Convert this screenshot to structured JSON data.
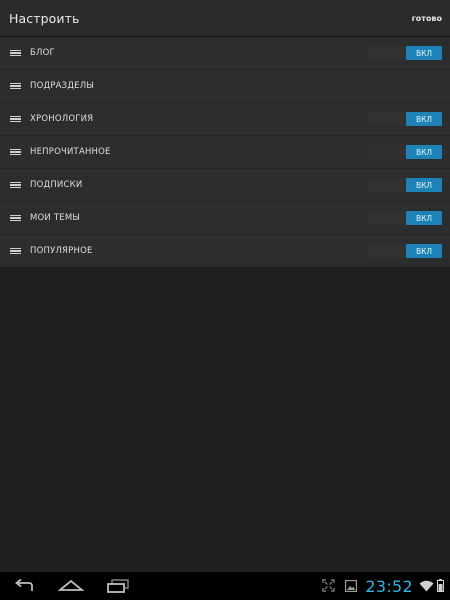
{
  "action_bar": {
    "title": "Настроить",
    "done_label": "готово"
  },
  "sections": [
    {
      "label": "БЛОГ",
      "toggle_label": "ВКЛ",
      "enabled": true
    },
    {
      "label": "ПОДРАЗДЕЛЫ",
      "toggle_label": "",
      "enabled": null
    },
    {
      "label": "ХРОНОЛОГИЯ",
      "toggle_label": "ВКЛ",
      "enabled": true
    },
    {
      "label": "НЕПРОЧИТАННОЕ",
      "toggle_label": "ВКЛ",
      "enabled": true
    },
    {
      "label": "ПОДПИСКИ",
      "toggle_label": "ВКЛ",
      "enabled": true
    },
    {
      "label": "МОИ ТЕМЫ",
      "toggle_label": "ВКЛ",
      "enabled": true
    },
    {
      "label": "ПОПУЛЯРНОЕ",
      "toggle_label": "ВКЛ",
      "enabled": true
    }
  ],
  "status_bar": {
    "time": "23:52",
    "icons": [
      "expand-icon",
      "gallery-icon",
      "wifi-icon",
      "battery-icon"
    ]
  },
  "nav_bar": {
    "buttons": [
      "back-icon",
      "home-icon",
      "recent-apps-icon"
    ]
  },
  "colors": {
    "accent": "#1d83b6",
    "clock": "#33b5e5",
    "background": "#1f2022",
    "list_background": "#2c2d2f"
  }
}
